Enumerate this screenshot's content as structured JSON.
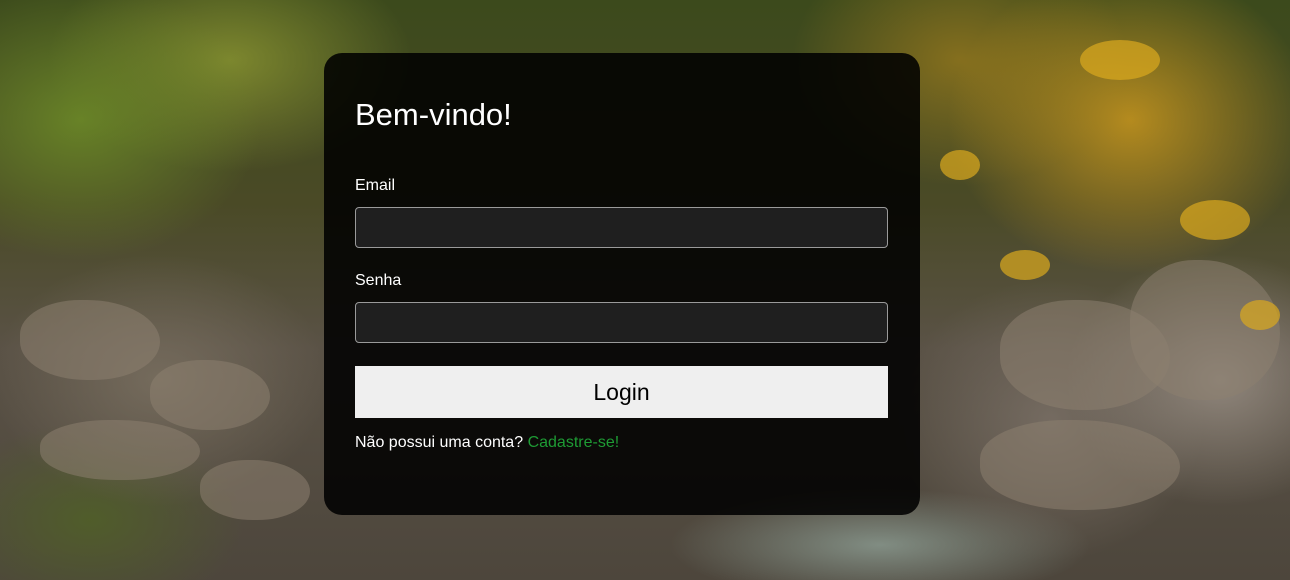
{
  "login": {
    "title": "Bem-vindo!",
    "email_label": "Email",
    "email_value": "",
    "password_label": "Senha",
    "password_value": "",
    "login_button": "Login",
    "signup_prompt": "Não possui uma conta?",
    "signup_link": "Cadastre-se!"
  },
  "colors": {
    "card_background": "#000000",
    "button_background": "#efefef",
    "link_color": "#1e9b34"
  }
}
